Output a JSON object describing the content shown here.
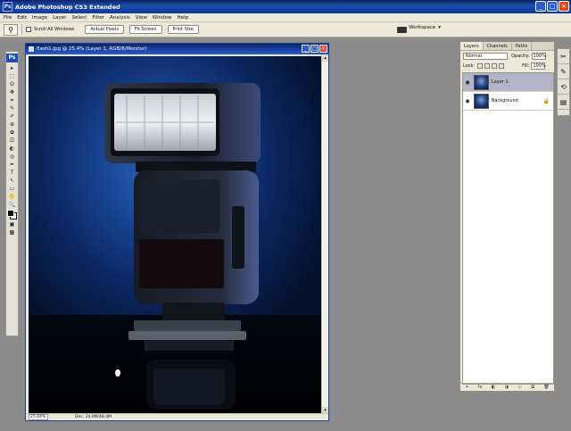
{
  "app": {
    "title": "Adobe Photoshop CS3 Extended",
    "icon_label": "Ps"
  },
  "window_buttons": [
    "_",
    "□",
    "×"
  ],
  "menus": [
    "File",
    "Edit",
    "Image",
    "Layer",
    "Select",
    "Filter",
    "Analysis",
    "View",
    "Window",
    "Help"
  ],
  "options_bar": {
    "tool_icon": "zoom-icon",
    "scroll_all_label": "Scroll All Windows",
    "actual_pixels_label": "Actual Pixels",
    "fit_screen_label": "Fit Screen",
    "print_size_label": "Print Size",
    "workspace_label": "Workspace"
  },
  "toolbox": {
    "logo": "Ps",
    "tools": [
      "▸",
      "⬚",
      "ʘ",
      "✥",
      "⌗",
      "✎",
      "✐",
      "⊕",
      "✿",
      "⎚",
      "◐",
      "◎",
      "✒",
      "T",
      "↖",
      "▭",
      "✋",
      "🔍"
    ]
  },
  "document": {
    "title": "flash1.jpg @ 25.4% (Layer 1, RGB/8/Monitor)",
    "zoom": "25.44%",
    "doc_info": "Doc: 24.0M/48.4M"
  },
  "layers_panel": {
    "tabs": [
      "Layers",
      "Channels",
      "Paths"
    ],
    "active_tab": 0,
    "blend_mode": "Normal",
    "opacity_label": "Opacity:",
    "opacity_value": "100%",
    "lock_label": "Lock:",
    "fill_label": "Fill:",
    "fill_value": "100%",
    "layers": [
      {
        "name": "Layer 1",
        "selected": true,
        "locked": false
      },
      {
        "name": "Background",
        "selected": false,
        "locked": true
      }
    ],
    "footer_icons": [
      "⚭",
      "fx",
      "◧",
      "◑",
      "▭",
      "⧉",
      "🗑"
    ]
  },
  "dock": [
    "✂",
    "✎",
    "⟲",
    "▤"
  ],
  "colors": {
    "title_blue": "#0a246a",
    "ui_beige": "#ece9d8",
    "workspace_gray": "#8b8b8b"
  }
}
